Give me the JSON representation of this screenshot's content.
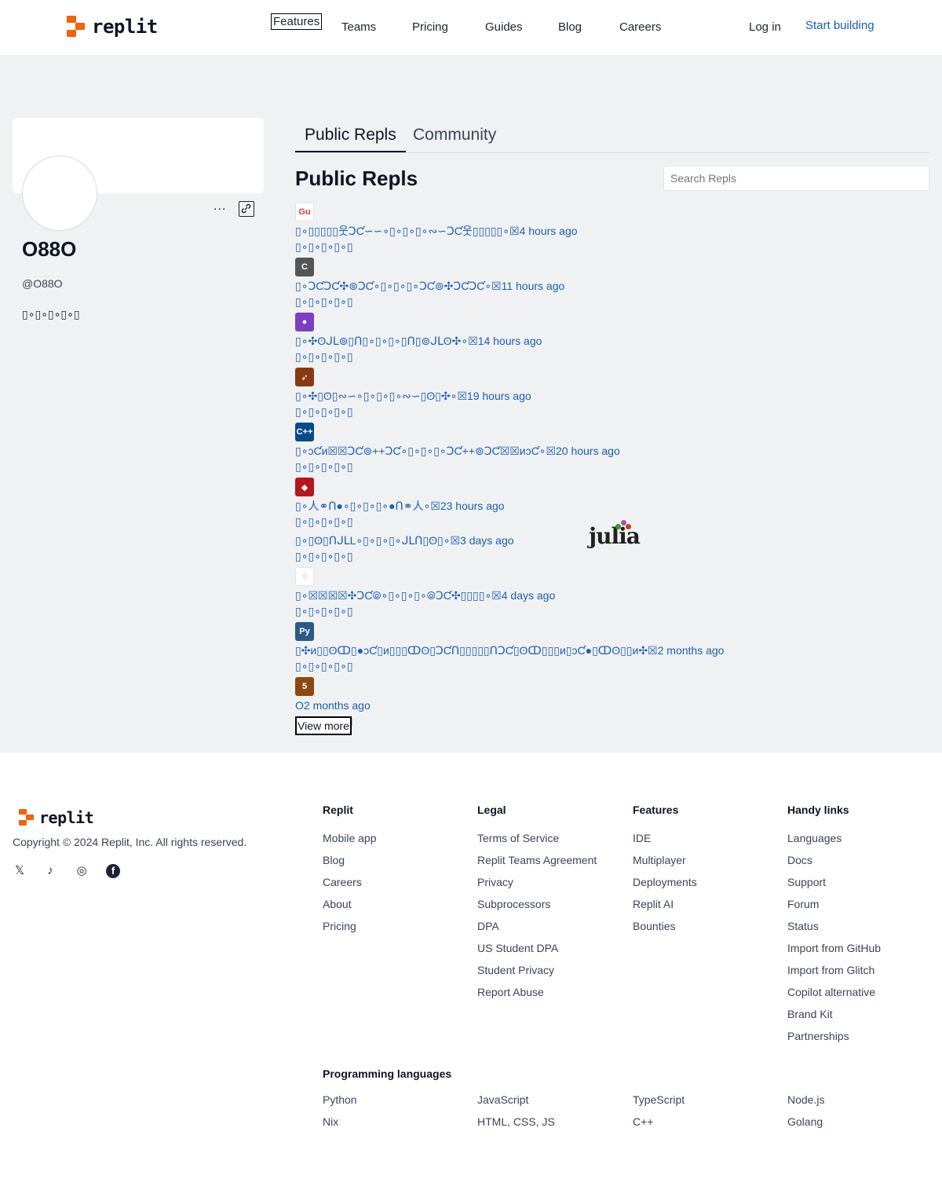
{
  "header": {
    "brand": "replit",
    "nav": [
      {
        "label": "Features"
      },
      {
        "label": "Teams"
      },
      {
        "label": "Pricing"
      },
      {
        "label": "Guides"
      },
      {
        "label": "Blog"
      },
      {
        "label": "Careers"
      }
    ],
    "login": "Log in",
    "start": "Start building"
  },
  "profile": {
    "more": "...",
    "name": "O88O",
    "handle": "@O88O",
    "bio": "▯∘▯∘▯∘▯∘▯"
  },
  "tabs": [
    "Public Repls",
    "Community"
  ],
  "section_title": "Public Repls",
  "search_placeholder": "Search Repls",
  "repls": [
    {
      "icon": "google-icon",
      "icon_label": "Gu",
      "color": "#ffffff",
      "title": "▯∘▯▯▯▯▯웃ↃƇ∽∽∘▯∘▯∘▯∘∾∽ↃƇ웃▯▯▯▯▯∘☒4 hours ago",
      "desc": "▯∘▯∘▯∘▯∘▯"
    },
    {
      "icon": "c-language-icon",
      "icon_label": "C",
      "color": "#555555",
      "title": "▯∘ↃƇↃƇ✣⊚ↃƇ∘▯∘▯∘▯∘ↃƇ⊚✣ↃƇↃƇ∘☒11 hours ago",
      "desc": "▯∘▯∘▯∘▯∘▯"
    },
    {
      "icon": "bomb-icon",
      "icon_label": "●",
      "color": "#7b3fc4",
      "title": "▯∘✣ʘᒍᒪ⊚▯Ո▯∘▯∘▯∘▯Ո▯⊚ᒍᒪʘ✣∘☒14 hours ago",
      "desc": "▯∘▯∘▯∘▯∘▯"
    },
    {
      "icon": "swift-icon",
      "icon_label": "➶",
      "color": "#8a3a12",
      "title": "▯∘✣▯ʘ▯∾∽∘▯∘▯∘▯∘∾∽▯ʘ▯✣∘☒19 hours ago",
      "desc": "▯∘▯∘▯∘▯∘▯"
    },
    {
      "icon": "cpp-icon",
      "icon_label": "C++",
      "color": "#0a4a8a",
      "title": "▯∘ↄƇᴎ☒☒ↃƇ⊚++ↃƇ∘▯∘▯∘▯∘ↃƇ++⊚ↃƇ☒☒ᴎↄƇ∘☒20 hours ago",
      "desc": "▯∘▯∘▯∘▯∘▯"
    },
    {
      "icon": "ruby-icon",
      "icon_label": "◆",
      "color": "#b3171b",
      "title": "▯∘人⚭Ո●∘▯∘▯∘▯∘●Ո⚭人∘☒23 hours ago",
      "desc": "▯∘▯∘▯∘▯∘▯"
    },
    {
      "icon": "julia-icon",
      "icon_label": "",
      "color": "",
      "title": "▯∘▯ʘ▯ՈᒍᒪL∘▯∘▯∘▯∘ᒍᒪՈ▯ʘ▯∘☒3 days ago",
      "desc": "▯∘▯∘▯∘▯∘▯"
    },
    {
      "icon": "ubuntu-icon",
      "icon_label": "◌",
      "color": "#ffffff",
      "title": "▯∘☒☒☒☒✣ↃƇ⦾∘▯∘▯∘▯∘⦾ↃƇ✣▯▯▯▯∘☒4 days ago",
      "desc": "▯∘▯∘▯∘▯∘▯"
    },
    {
      "icon": "python-icon",
      "icon_label": "Py",
      "color": "#2b5b84",
      "title": "▯✣ᴎ▯▯ʘↀ▯●ↄƇ▯ᴎ▯▯▯ↀʘ▯ↃƇՈ▯▯▯▯▯ՈↃƇ▯ʘↀ▯▯▯ᴎ▯ↄƇ●▯ↀʘ▯▯ᴎ✣☒2 months ago",
      "desc": "▯∘▯∘▯∘▯∘▯"
    },
    {
      "icon": "html5-icon",
      "icon_label": "5",
      "color": "#8a4a10",
      "title": "O2 months ago",
      "desc": "▯∘▯∘▯∘▯∘▯"
    }
  ],
  "julia_logo": "julia",
  "view_more": "View more",
  "footer": {
    "brand": "replit",
    "copyright": "Copyright © 2024 Replit, Inc. All rights reserved.",
    "social": [
      {
        "icon": "x-twitter-icon",
        "glyph": "𝕏"
      },
      {
        "icon": "tiktok-icon",
        "glyph": "♪"
      },
      {
        "icon": "instagram-icon",
        "glyph": "◎"
      },
      {
        "icon": "facebook-icon",
        "glyph": "f"
      }
    ],
    "columns": [
      {
        "title": "Replit",
        "links": [
          "Mobile app",
          "Blog",
          "Careers",
          "About",
          "Pricing"
        ]
      },
      {
        "title": "Legal",
        "links": [
          "Terms of Service",
          "Replit Teams Agreement",
          "Privacy",
          "Subprocessors",
          "DPA",
          "US Student DPA",
          "Student Privacy",
          "Report Abuse"
        ]
      },
      {
        "title": "Features",
        "links": [
          "IDE",
          "Multiplayer",
          "Deployments",
          "Replit AI",
          "Bounties"
        ]
      },
      {
        "title": "Handy links",
        "links": [
          "Languages",
          "Docs",
          "Support",
          "Forum",
          "Status",
          "Import from GitHub",
          "Import from Glitch",
          "Copilot alternative",
          "Brand Kit",
          "Partnerships"
        ]
      }
    ],
    "languages_title": "Programming languages",
    "languages": [
      [
        "Python",
        "Nix"
      ],
      [
        "JavaScript",
        "HTML, CSS, JS"
      ],
      [
        "TypeScript",
        "C++"
      ],
      [
        "Node.js",
        "Golang"
      ]
    ]
  }
}
